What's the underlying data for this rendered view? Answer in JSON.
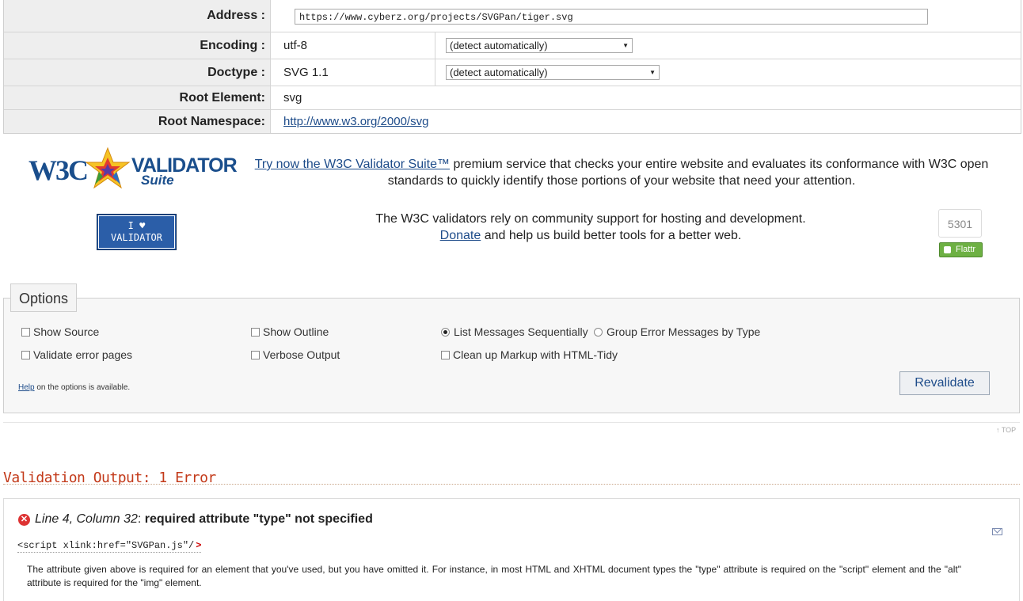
{
  "info": {
    "address_label": "Address :",
    "address_value": "https://www.cyberz.org/projects/SVGPan/tiger.svg",
    "encoding_label": "Encoding :",
    "encoding_value": "utf-8",
    "encoding_select": "(detect automatically)",
    "doctype_label": "Doctype :",
    "doctype_value": "SVG 1.1",
    "doctype_select": "(detect automatically)",
    "root_element_label": "Root Element:",
    "root_element_value": "svg",
    "root_namespace_label": "Root Namespace:",
    "root_namespace_value": "http://www.w3.org/2000/svg"
  },
  "promo": {
    "logo_w3c": "W3C",
    "logo_validator": "VALIDATOR",
    "logo_suite": "Suite",
    "suite_link": "Try now the W3C Validator Suite™",
    "suite_text": " premium service that checks your entire website and evaluates its conformance with W3C open standards to quickly identify those portions of your website that need your attention.",
    "badge_line1": "I ♥",
    "badge_line2": "VALIDATOR",
    "support_text": "The W3C validators rely on community support for hosting and development.",
    "donate_link": "Donate",
    "donate_text": " and help us build better tools for a better web.",
    "flattr_count": "5301",
    "flattr_label": "Flattr"
  },
  "options": {
    "legend": "Options",
    "show_source": "Show Source",
    "show_outline": "Show Outline",
    "list_sequential": "List Messages Sequentially",
    "group_by_type": "Group Error Messages by Type",
    "validate_error_pages": "Validate error pages",
    "verbose_output": "Verbose Output",
    "cleanup_tidy": "Clean up Markup with HTML-Tidy",
    "help_link": "Help",
    "help_text": " on the options is available.",
    "revalidate": "Revalidate",
    "top_link": "↑ TOP"
  },
  "output": {
    "title": "Validation Output: 1 Error",
    "error_location": "Line 4, Column 32",
    "error_sep": ": ",
    "error_message": "required attribute \"type\" not specified",
    "code": "<script xlink:href=\"SVGPan.js\"/",
    "code_marker": ">",
    "explanation": "The attribute given above is required for an element that you've used, but you have omitted it. For instance, in most HTML and XHTML document types the \"type\" attribute is required on the \"script\" element and the \"alt\" attribute is required for the \"img\" element."
  }
}
